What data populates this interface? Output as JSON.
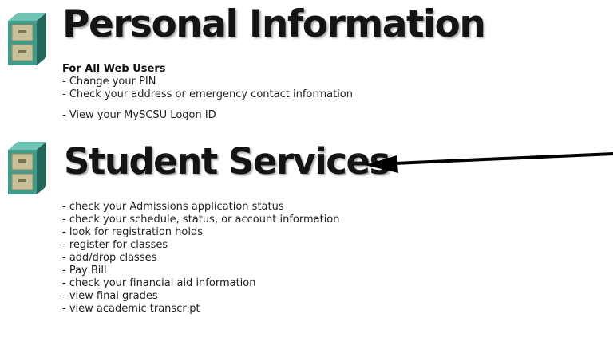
{
  "personal": {
    "title": "Personal Information",
    "subtitle": "For All Web Users",
    "items": [
      {
        "label": "- Change your PIN"
      },
      {
        "label": "- Check your address or emergency contact information"
      },
      {
        "label": "- View your MySCSU Logon ID"
      }
    ]
  },
  "student": {
    "title": "Student Services",
    "items": [
      {
        "label": "- check your Admissions application status"
      },
      {
        "label": "- check your schedule, status, or account information"
      },
      {
        "label": "- look for registration holds"
      },
      {
        "label": "- register for classes"
      },
      {
        "label": "- add/drop classes"
      },
      {
        "label": "- Pay Bill"
      },
      {
        "label": "- check your financial aid information"
      },
      {
        "label": "- view final grades"
      },
      {
        "label": "- view academic transcript"
      }
    ]
  },
  "icons": {
    "cabinet": "file-cabinet-icon",
    "arrow": "left-arrow-icon"
  },
  "colors": {
    "cabinet_front": "#3f9c8c",
    "cabinet_drawer": "#c8c098",
    "heading_text": "#141414",
    "heading_shadow": "#a9a9a9"
  }
}
